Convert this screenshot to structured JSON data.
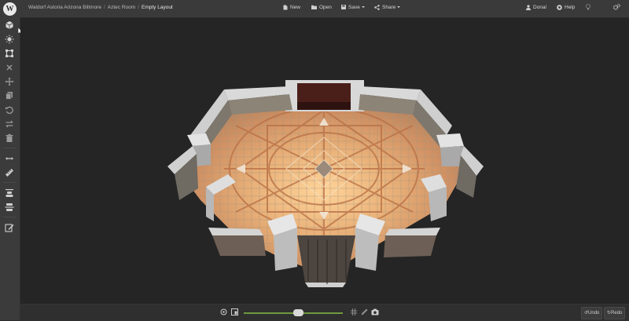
{
  "app": {
    "logo_letter": "W"
  },
  "breadcrumb": [
    "Waldorf Astoria Arizona Biltmore",
    "Aztec Room",
    "Empty Layout"
  ],
  "toolbar": {
    "new_label": "New",
    "open_label": "Open",
    "save_label": "Save",
    "share_label": "Share"
  },
  "user": {
    "name": "Donal",
    "help_label": "Help"
  },
  "sidebar": {
    "items": [
      "cube-icon",
      "lightbulb-icon",
      "crop-icon",
      "close-icon",
      "move-icon",
      "copy-icon",
      "rotate-icon",
      "swap-icon",
      "trash-icon",
      "measure-icon",
      "ruler-icon",
      "align-top-icon",
      "align-middle-icon",
      "edit-icon"
    ]
  },
  "bottombar": {
    "zoom_level": 0.55,
    "undo_label": "Undo",
    "redo_label": "Redo"
  },
  "colors": {
    "accent": "#6f9a3e",
    "topbar": "#3a3a3a",
    "sidebar": "#3b3b3b",
    "viewport": "#252525"
  }
}
